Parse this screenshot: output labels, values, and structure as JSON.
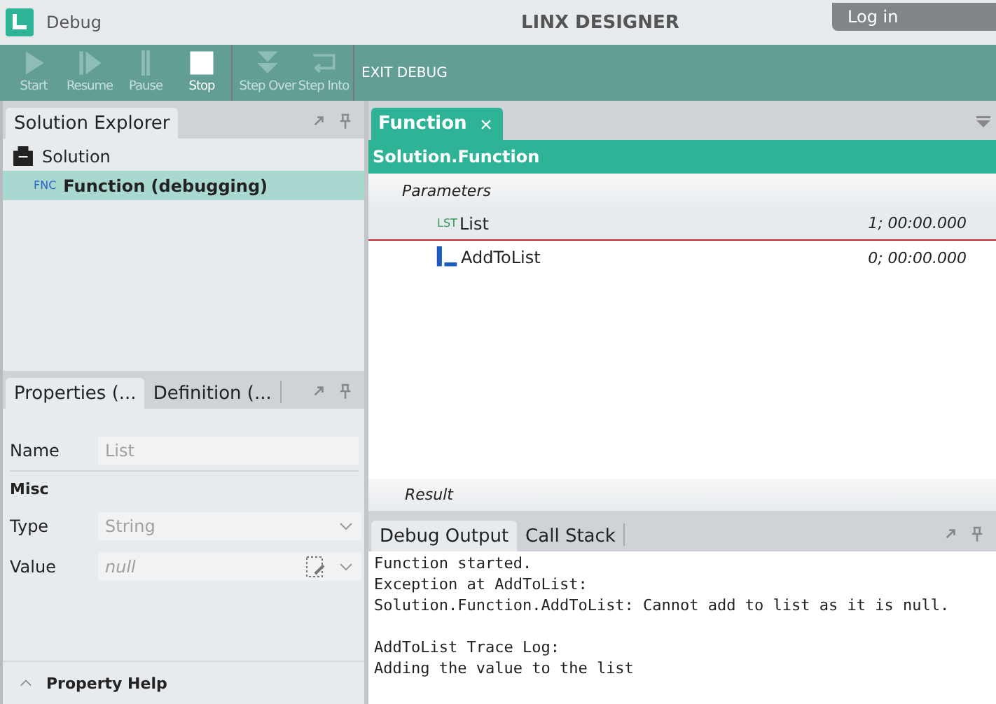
{
  "window": {
    "title": "Debug",
    "app_name": "LINX DESIGNER",
    "login_button": "Log in"
  },
  "toolbar": {
    "groups": [
      [
        {
          "label": "Start",
          "kind": "play",
          "disabled": true
        },
        {
          "label": "Resume",
          "kind": "resume",
          "disabled": true
        },
        {
          "label": "Pause",
          "kind": "pause",
          "disabled": true
        },
        {
          "label": "Stop",
          "kind": "stop",
          "disabled": false
        }
      ],
      [
        {
          "label": "Step Over",
          "kind": "step-over",
          "disabled": true
        },
        {
          "label": "Step Into",
          "kind": "step-into",
          "disabled": true
        }
      ]
    ],
    "exit_button": "EXIT DEBUG"
  },
  "solution_explorer": {
    "tab": "Solution Explorer",
    "items": [
      {
        "label": "Solution",
        "kind": "solution",
        "selected": false,
        "children": [
          {
            "label": "Function (debugging)",
            "kind": "function",
            "badge": "FNC",
            "selected": true
          }
        ]
      }
    ]
  },
  "properties": {
    "tabs": [
      {
        "label": "Properties (...",
        "selected": true
      },
      {
        "label": "Definition (...",
        "selected": false
      }
    ],
    "rows": [
      {
        "kind": "field",
        "label": "Name",
        "value": "List"
      },
      {
        "kind": "section",
        "label": "Misc"
      },
      {
        "kind": "dropdown",
        "label": "Type",
        "value": "String"
      },
      {
        "kind": "editor",
        "label": "Value",
        "value": "null"
      }
    ],
    "help": "Property Help"
  },
  "document": {
    "tabs": [
      {
        "label": "Function",
        "selected": true
      }
    ],
    "header": "Solution.Function",
    "parameters_label": "Parameters",
    "steps": [
      {
        "kind": "list",
        "badge": "LST",
        "label": "List",
        "reading": "1; 00:00.000",
        "selected": true
      },
      {
        "kind": "action",
        "label": "AddToList",
        "reading": "0; 00:00.000",
        "selected": false
      }
    ],
    "result_label": "Result"
  },
  "output": {
    "tabs": [
      {
        "label": "Debug Output",
        "selected": true
      },
      {
        "label": "Call Stack",
        "selected": false
      }
    ],
    "text": "Function started.\nException at AddToList:\nSolution.Function.AddToList: Cannot add to list as it is null.\n\nAddToList Trace Log:\nAdding the value to the list"
  }
}
